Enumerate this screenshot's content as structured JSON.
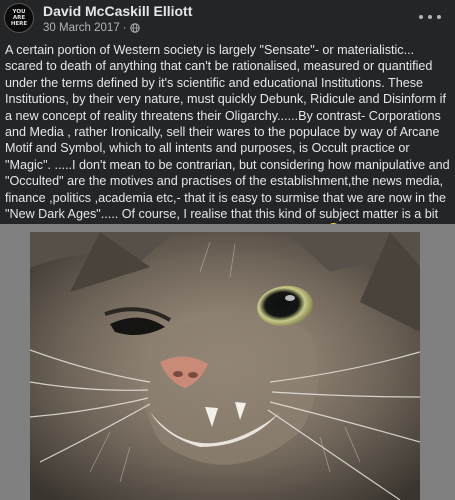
{
  "post": {
    "author": "David McCaskill Elliott",
    "date": "30 March 2017",
    "separator": "·",
    "avatar_text": [
      "YOU",
      "ARE",
      "HERE"
    ],
    "text": "A certain portion of Western society is  largely \"Sensate\"- or materialistic... scared to death of anything that can't be rationalised, measured or quantified under the terms defined by it's scientific and educational Institutions. These Institutions, by their very nature, must quickly Debunk, Ridicule and Disinform if a new concept of reality threatens their Oligarchy......By contrast- Corporations and Media , rather Ironically, sell their wares to the populace by way of Arcane Motif and Symbol, which to all intents and purposes, is Occult practice or \"Magic\". .....I don't mean to be contrarian, but considering how manipulative and \"Occulted\" are the motives and practises of the establishment,the news media, finance ,politics ,academia etc,- that it is easy to surmise that we are now in the \"New Dark Ages\"..... Of course, I realise that this kind of subject matter is a bit heavy, so I'll end this Rant with a cute picture of a cat......"
  },
  "icons": {
    "privacy": "globe-icon",
    "menu": "more-options-icon",
    "emoji": "smiling-face-emoji"
  },
  "colors": {
    "background": "#242526",
    "text": "#e4e6eb",
    "secondary_text": "#b0b3b8",
    "photo_frame": "#808080"
  }
}
